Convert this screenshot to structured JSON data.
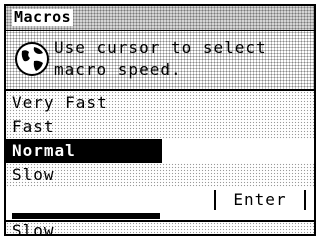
{
  "window": {
    "title": "Macros"
  },
  "prompt": {
    "icon": "globe-icon",
    "line1": "Use cursor to select",
    "line2": "macro speed."
  },
  "options": [
    {
      "label": "Very Fast",
      "selected": false
    },
    {
      "label": "Fast",
      "selected": false
    },
    {
      "label": "Normal",
      "selected": true
    },
    {
      "label": "Slow",
      "selected": false
    }
  ],
  "actions": {
    "enter_label": "Enter"
  },
  "background_list": {
    "visible_item": "Slow"
  }
}
